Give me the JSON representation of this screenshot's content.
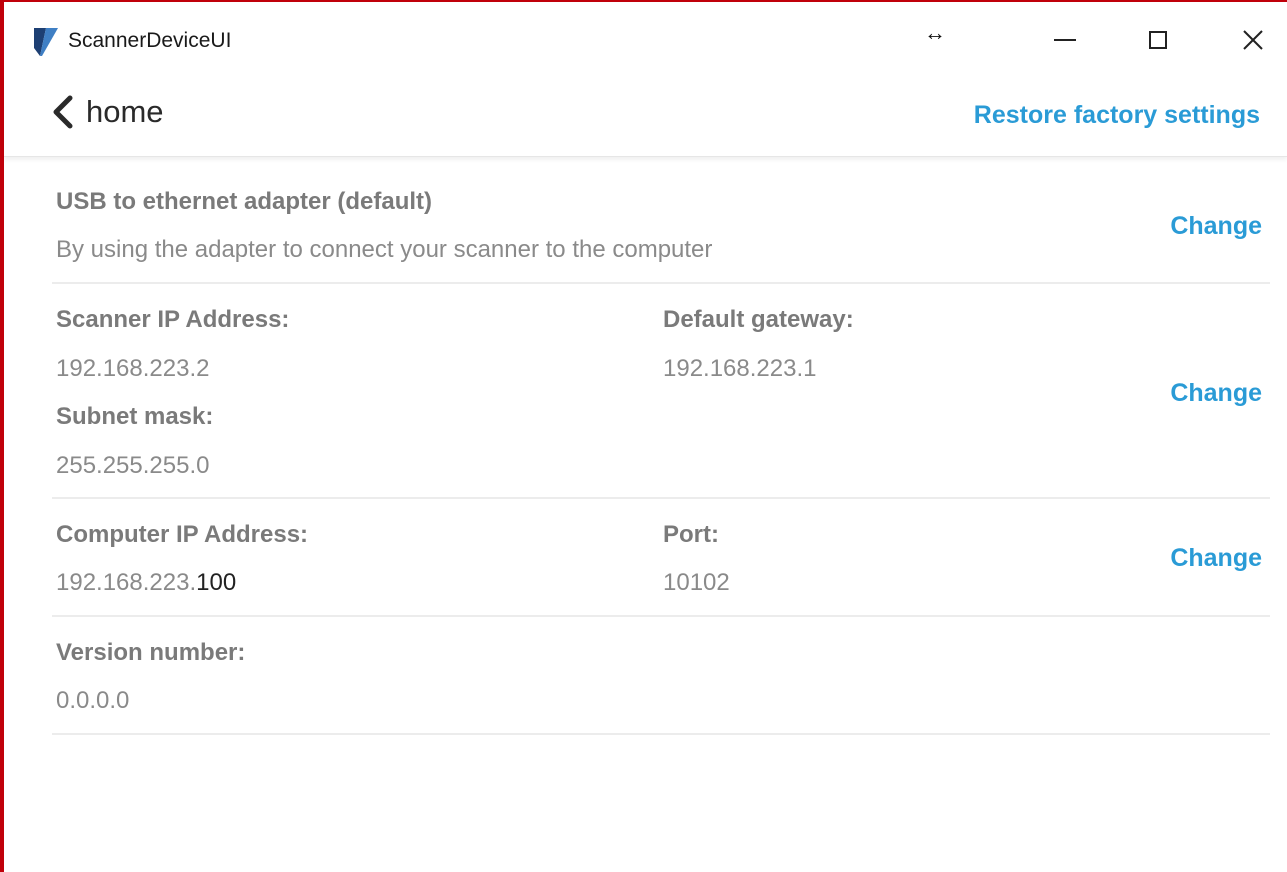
{
  "window": {
    "title": "ScannerDeviceUI",
    "controls": {
      "minimize": "minimize-icon",
      "maximize": "maximize-icon",
      "close": "close-icon"
    },
    "cursor_glyph": "↔"
  },
  "header": {
    "back_label": "home",
    "restore_label": "Restore factory settings"
  },
  "adapter": {
    "title": "USB to ethernet adapter (default)",
    "description": "By using the adapter to connect your scanner to the computer",
    "change_label": "Change"
  },
  "network": {
    "scanner_ip_label": "Scanner IP Address:",
    "scanner_ip_value": "192.168.223.2",
    "subnet_label": "Subnet mask:",
    "subnet_value": "255.255.255.0",
    "gateway_label": "Default gateway:",
    "gateway_value": "192.168.223.1",
    "change_label": "Change"
  },
  "computer": {
    "ip_label": "Computer IP Address:",
    "ip_prefix": "192.168.223.",
    "ip_suffix": "100",
    "port_label": "Port:",
    "port_value": "10102",
    "change_label": "Change"
  },
  "version": {
    "label": "Version number:",
    "value": "0.0.0.0"
  },
  "colors": {
    "accent": "#2a9bd6",
    "frame": "#c0000a",
    "label": "#7a7a7a",
    "value": "#8a8a8a"
  }
}
